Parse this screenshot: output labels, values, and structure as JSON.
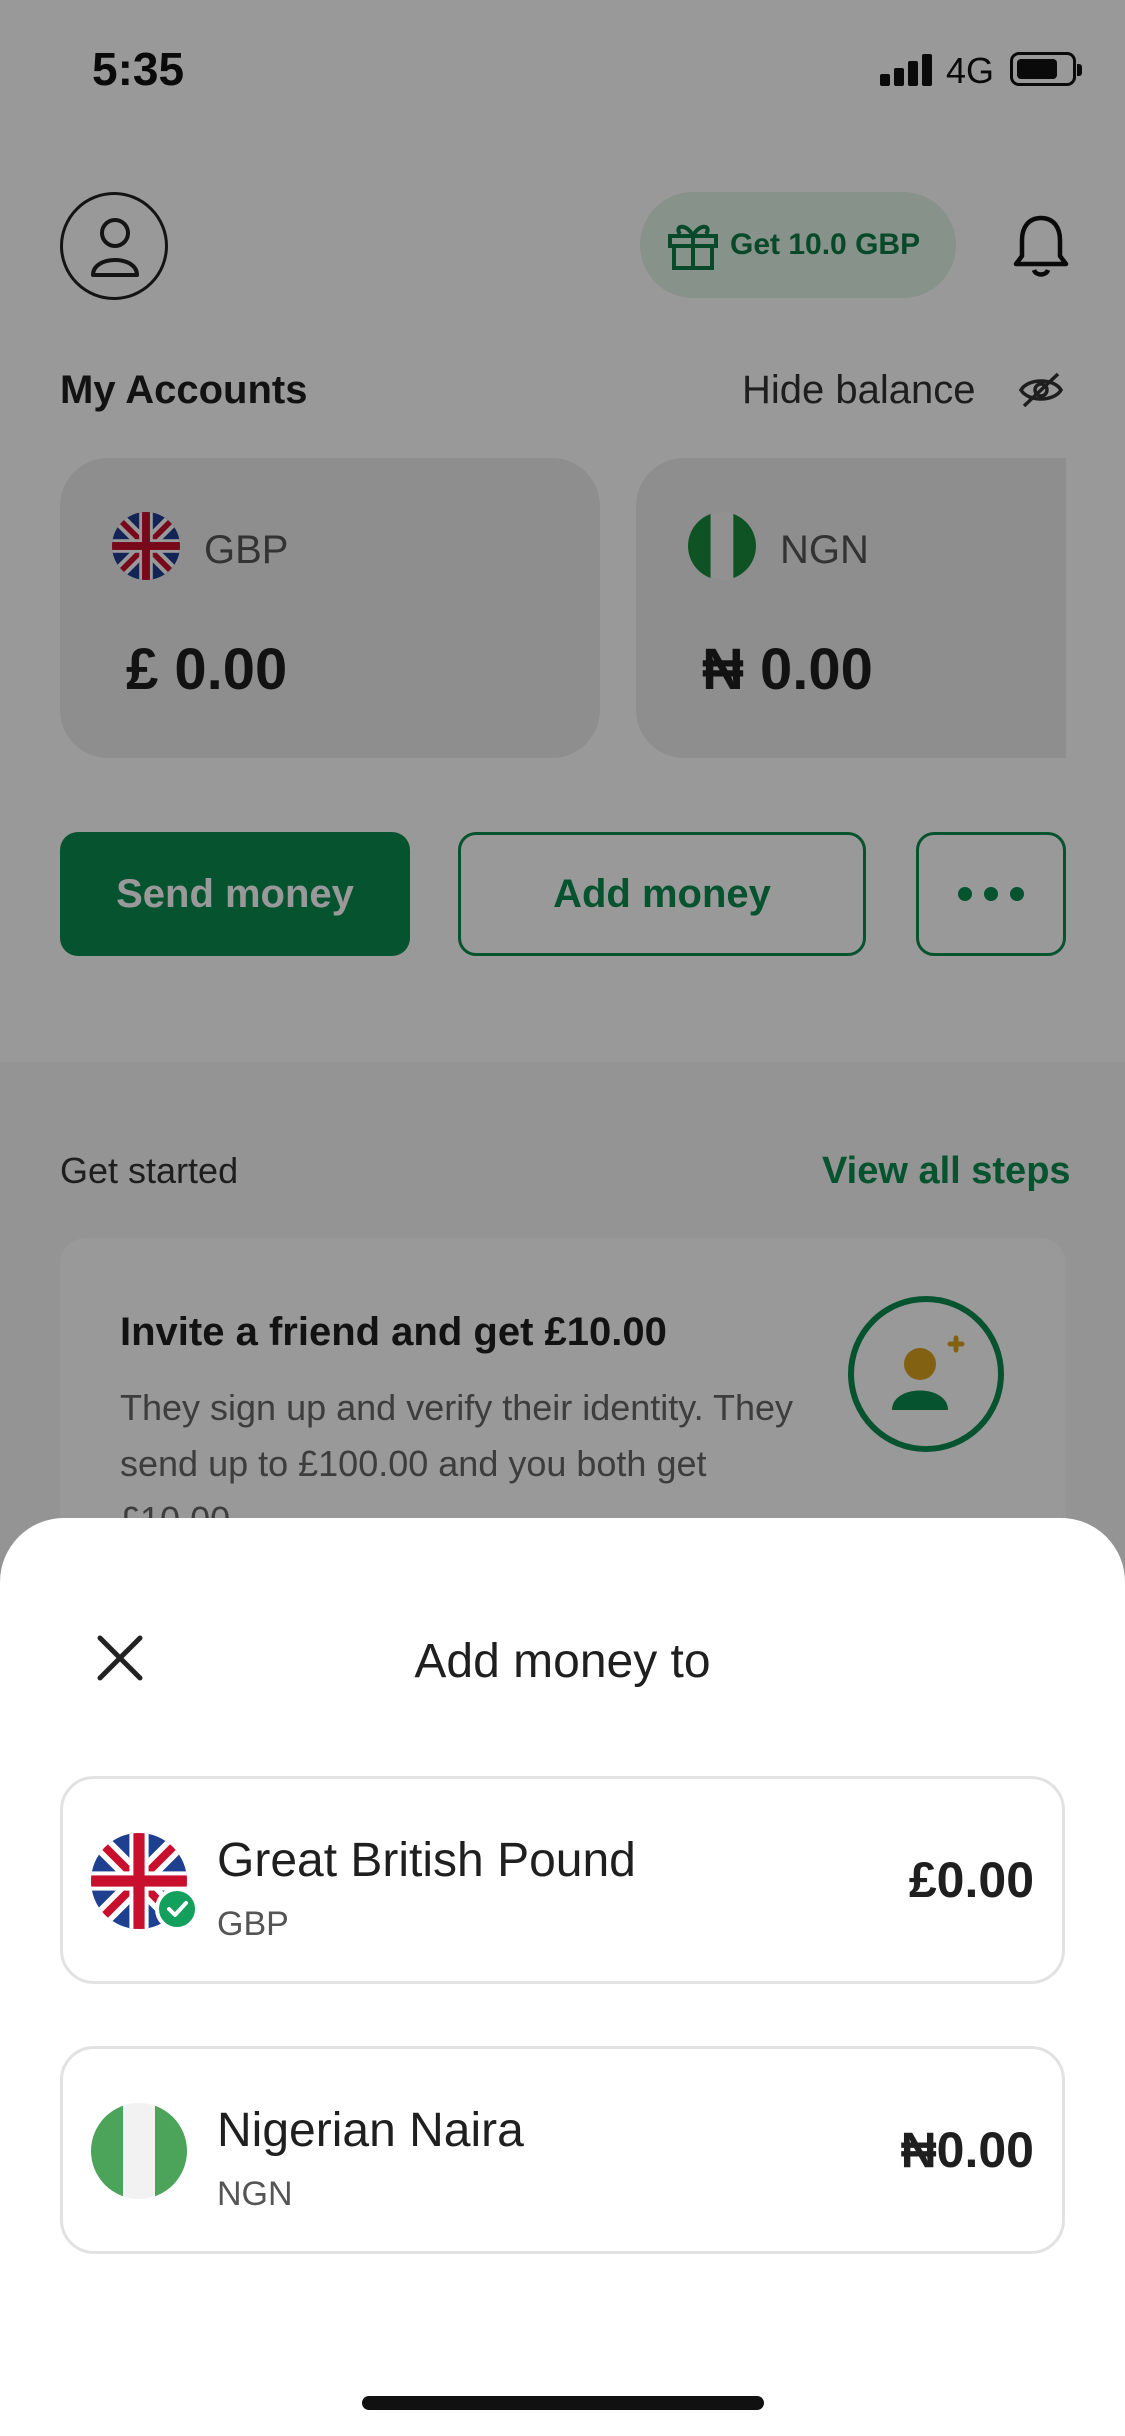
{
  "status_bar": {
    "time": "5:35",
    "network": "4G"
  },
  "header": {
    "referral_label": "Get 10.0 GBP"
  },
  "accounts": {
    "title": "My Accounts",
    "hide_balance_label": "Hide balance",
    "items": [
      {
        "code": "GBP",
        "balance": "£ 0.00"
      },
      {
        "code": "NGN",
        "balance": "₦ 0.00"
      }
    ]
  },
  "actions": {
    "send_label": "Send money",
    "add_label": "Add money"
  },
  "get_started": {
    "title": "Get started",
    "link": "View all steps",
    "invite_title": "Invite a friend and get £10.00",
    "invite_body": "They sign up and verify their identity. They send up to £100.00 and you both get £10.00"
  },
  "sheet": {
    "title": "Add money to",
    "currencies": [
      {
        "name": "Great British Pound",
        "code": "GBP",
        "amount": "£0.00"
      },
      {
        "name": "Nigerian Naira",
        "code": "NGN",
        "amount": "₦0.00"
      }
    ]
  },
  "colors": {
    "brand_green": "#0a8a4f",
    "check_green": "#12a05c",
    "pill_bg": "#dff3e6"
  }
}
